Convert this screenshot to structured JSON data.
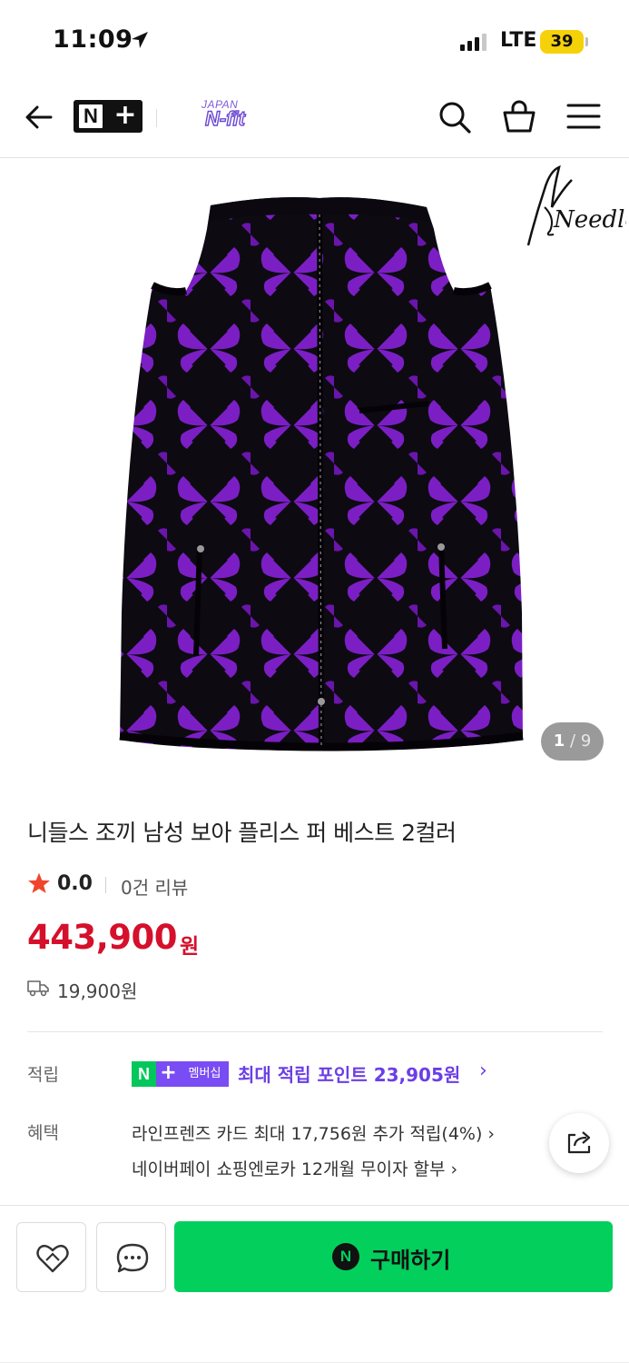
{
  "status_bar": {
    "time": "11:09",
    "network": "LTE",
    "battery": "39"
  },
  "header": {
    "nplus_logo": {
      "n": "N",
      "plus": "+"
    },
    "store_logo": {
      "top": "JAPAN",
      "bottom": "N-fit"
    },
    "icons": [
      "back-icon",
      "search-icon",
      "cart-icon",
      "menu-icon"
    ]
  },
  "gallery": {
    "current": "1",
    "separator": "/",
    "total": "9",
    "brand": "Needles"
  },
  "product": {
    "title": "니들스 조끼 남성 보아 플리스 퍼 베스트 2컬러",
    "rating": "0.0",
    "review_count": "0건 리뷰",
    "price": "443,900",
    "price_unit": "원",
    "shipping_fee": "19,900원"
  },
  "points": {
    "label": "적립",
    "badge_n": "N",
    "badge_plus": "+",
    "badge_text": "멤버십",
    "text": "최대 적립 포인트 23,905원",
    "arrow": "›"
  },
  "benefits": {
    "label": "혜택",
    "lines": [
      "라인프렌즈 카드 최대 17,756원 추가 적립(4%) ›",
      "네이버페이 쇼핑엔로카 12개월 무이자 할부 ›"
    ]
  },
  "bottom_bar": {
    "buy_icon_letter": "N",
    "buy_label": "구매하기"
  },
  "colors": {
    "price_red": "#d5102b",
    "naver_green": "#03cf5d",
    "membership_purple": "#7a4cf3",
    "product_purple": "#7b1fc4"
  }
}
